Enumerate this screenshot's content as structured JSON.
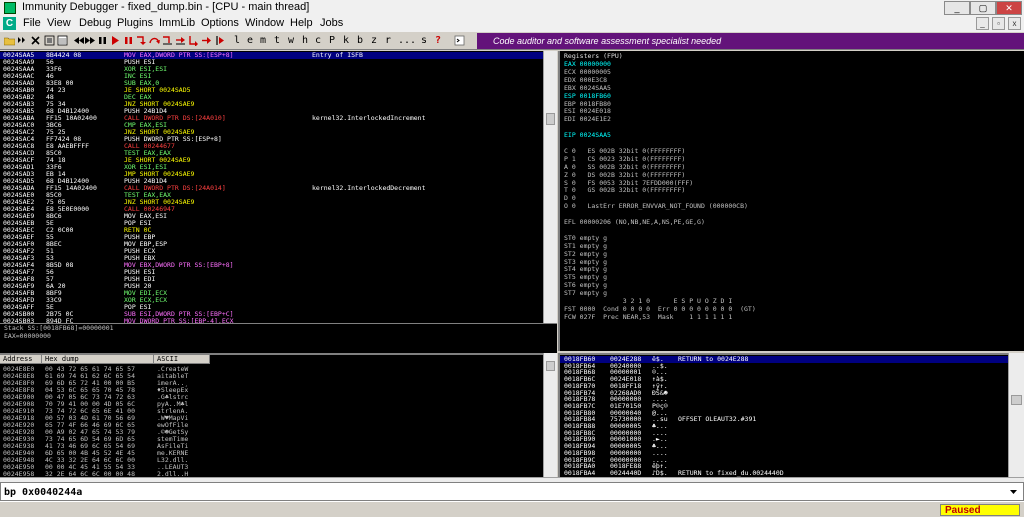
{
  "window": {
    "title": "Immunity Debugger - fixed_dump.bin - [CPU - main thread]",
    "min_label": "_",
    "max_label": "▢",
    "close_label": "✕"
  },
  "menu": {
    "icon_letter": "C",
    "items": [
      "File",
      "View",
      "Debug",
      "Plugins",
      "ImmLib",
      "Options",
      "Window",
      "Help",
      "Jobs"
    ]
  },
  "toolbar": {
    "letters": [
      "l",
      "e",
      "m",
      "t",
      "w",
      "h",
      "c",
      "P",
      "k",
      "b",
      "z",
      "r",
      "...",
      "s",
      "?"
    ],
    "banner": "Code auditor and software assessment specialist needed"
  },
  "disasm": {
    "rows": [
      {
        "addr": "0024SAA5",
        "hex": "8B4424 08",
        "asm": "MOV EAX,DWORD PTR SS:[ESP+8]",
        "cmt": "Entry of ISFB",
        "sel": true,
        "cls": "mov"
      },
      {
        "addr": "0024SAA9",
        "hex": "56",
        "asm": "PUSH ESI",
        "cmt": "",
        "cls": "push"
      },
      {
        "addr": "0024SAAA",
        "hex": "33F6",
        "asm": "XOR ESI,ESI",
        "cmt": "",
        "cls": "arith"
      },
      {
        "addr": "0024SAAC",
        "hex": "46",
        "asm": "INC ESI",
        "cmt": "",
        "cls": "arith"
      },
      {
        "addr": "0024SAAD",
        "hex": "83E8 00",
        "asm": "SUB EAX,0",
        "cmt": "",
        "cls": "arith"
      },
      {
        "addr": "0024SAB0",
        "hex": "74 23",
        "asm": "JE SHORT 0024SAD5",
        "cmt": "",
        "cls": "jmp"
      },
      {
        "addr": "0024SAB2",
        "hex": "48",
        "asm": "DEC EAX",
        "cmt": "",
        "cls": "arith"
      },
      {
        "addr": "0024SAB3",
        "hex": "75 34",
        "asm": "JNZ SHORT 0024SAE9",
        "cmt": "",
        "cls": "jmp"
      },
      {
        "addr": "0024SAB5",
        "hex": "68 D4B12400",
        "asm": "PUSH 24B1D4",
        "cmt": "",
        "cls": "push"
      },
      {
        "addr": "0024SABA",
        "hex": "FF15 10A02400",
        "asm": "CALL DWORD PTR DS:[24A010]",
        "cmt": "kernel32.InterlockedIncrement",
        "cls": "call"
      },
      {
        "addr": "0024SAC0",
        "hex": "3BC6",
        "asm": "CMP EAX,ESI",
        "cmt": "",
        "cls": "arith"
      },
      {
        "addr": "0024SAC2",
        "hex": "75 25",
        "asm": "JNZ SHORT 0024SAE9",
        "cmt": "",
        "cls": "jmp"
      },
      {
        "addr": "0024SAC4",
        "hex": "FF7424 08",
        "asm": "PUSH DWORD PTR SS:[ESP+8]",
        "cmt": "",
        "cls": "push"
      },
      {
        "addr": "0024SAC8",
        "hex": "E8 AAEBFFFF",
        "asm": "CALL 00244677",
        "cmt": "",
        "cls": "call"
      },
      {
        "addr": "0024SACD",
        "hex": "85C0",
        "asm": "TEST EAX,EAX",
        "cmt": "",
        "cls": "arith"
      },
      {
        "addr": "0024SACF",
        "hex": "74 18",
        "asm": "JE SHORT 0024SAE9",
        "cmt": "",
        "cls": "jmp"
      },
      {
        "addr": "0024SAD1",
        "hex": "33F6",
        "asm": "XOR ESI,ESI",
        "cmt": "",
        "cls": "arith"
      },
      {
        "addr": "0024SAD3",
        "hex": "EB 14",
        "asm": "JMP SHORT 0024SAE9",
        "cmt": "",
        "cls": "jmp"
      },
      {
        "addr": "0024SAD5",
        "hex": "68 D4B12400",
        "asm": "PUSH 24B1D4",
        "cmt": "",
        "cls": "push"
      },
      {
        "addr": "0024SADA",
        "hex": "FF15 14A02400",
        "asm": "CALL DWORD PTR DS:[24A014]",
        "cmt": "kernel32.InterlockedDecrement",
        "cls": "call"
      },
      {
        "addr": "0024SAE0",
        "hex": "85C0",
        "asm": "TEST EAX,EAX",
        "cmt": "",
        "cls": "arith"
      },
      {
        "addr": "0024SAE2",
        "hex": "75 05",
        "asm": "JNZ SHORT 0024SAE9",
        "cmt": "",
        "cls": "jmp"
      },
      {
        "addr": "0024SAE4",
        "hex": "E8 5E0E0000",
        "asm": "CALL 00246947",
        "cmt": "",
        "cls": "call"
      },
      {
        "addr": "0024SAE9",
        "hex": "8BC6",
        "asm": "MOV EAX,ESI",
        "cmt": "",
        "cls": "plain"
      },
      {
        "addr": "0024SAEB",
        "hex": "5E",
        "asm": "POP ESI",
        "cmt": "",
        "cls": "push"
      },
      {
        "addr": "0024SAEC",
        "hex": "C2 0C00",
        "asm": "RETN 0C",
        "cmt": "",
        "cls": "jmp"
      },
      {
        "addr": "0024SAEF",
        "hex": "55",
        "asm": "PUSH EBP",
        "cmt": "",
        "cls": "push"
      },
      {
        "addr": "0024SAF0",
        "hex": "8BEC",
        "asm": "MOV EBP,ESP",
        "cmt": "",
        "cls": "plain"
      },
      {
        "addr": "0024SAF2",
        "hex": "51",
        "asm": "PUSH ECX",
        "cmt": "",
        "cls": "push"
      },
      {
        "addr": "0024SAF3",
        "hex": "53",
        "asm": "PUSH EBX",
        "cmt": "",
        "cls": "push"
      },
      {
        "addr": "0024SAF4",
        "hex": "8B5D 08",
        "asm": "MOV EBX,DWORD PTR SS:[EBP+8]",
        "cmt": "",
        "cls": "mov"
      },
      {
        "addr": "0024SAF7",
        "hex": "56",
        "asm": "PUSH ESI",
        "cmt": "",
        "cls": "push"
      },
      {
        "addr": "0024SAF8",
        "hex": "57",
        "asm": "PUSH EDI",
        "cmt": "",
        "cls": "push"
      },
      {
        "addr": "0024SAF9",
        "hex": "6A 20",
        "asm": "PUSH 20",
        "cmt": "",
        "cls": "push"
      },
      {
        "addr": "0024SAFB",
        "hex": "8BF9",
        "asm": "MOV EDI,ECX",
        "cmt": "",
        "cls": "arith"
      },
      {
        "addr": "0024SAFD",
        "hex": "33C9",
        "asm": "XOR ECX,ECX",
        "cmt": "",
        "cls": "arith"
      },
      {
        "addr": "0024SAFF",
        "hex": "5E",
        "asm": "POP ESI",
        "cmt": "",
        "cls": "push"
      },
      {
        "addr": "0024SB00",
        "hex": "2B75 0C",
        "asm": "SUB ESI,DWORD PTR SS:[EBP+C]",
        "cmt": "",
        "cls": "mov"
      },
      {
        "addr": "0024SB03",
        "hex": "894D FC",
        "asm": "MOV DWORD PTR SS:[EBP-4],ECX",
        "cmt": "",
        "cls": "mov"
      }
    ]
  },
  "info": {
    "line1": "Stack SS:[0018FB68]=00000001",
    "line2": "EAX=00000000"
  },
  "registers": {
    "title": "Registers (FPU)",
    "lines": [
      {
        "t": "EAX 00000000",
        "c": "hl"
      },
      {
        "t": "ECX 00000005",
        "c": ""
      },
      {
        "t": "EDX 000E3C8",
        "c": ""
      },
      {
        "t": "EBX 0024SAA5",
        "c": ""
      },
      {
        "t": "ESP 0018FB60",
        "c": "hl"
      },
      {
        "t": "EBP 0018FB80",
        "c": ""
      },
      {
        "t": "ESI 0024E018",
        "c": ""
      },
      {
        "t": "EDI 0024E1E2",
        "c": ""
      },
      {
        "t": "",
        "c": ""
      },
      {
        "t": "EIP 0024SAA5",
        "c": "hl"
      },
      {
        "t": "",
        "c": ""
      },
      {
        "t": "C 0   ES 002B 32bit 0(FFFFFFFF)",
        "c": ""
      },
      {
        "t": "P 1   CS 0023 32bit 0(FFFFFFFF)",
        "c": ""
      },
      {
        "t": "A 0   SS 002B 32bit 0(FFFFFFFF)",
        "c": ""
      },
      {
        "t": "Z 0   DS 002B 32bit 0(FFFFFFFF)",
        "c": ""
      },
      {
        "t": "S 0   FS 0053 32bit 7EFDD000(FFF)",
        "c": ""
      },
      {
        "t": "T 0   GS 002B 32bit 0(FFFFFFFF)",
        "c": ""
      },
      {
        "t": "D 0",
        "c": ""
      },
      {
        "t": "O 0   LastErr ERROR_ENVVAR_NOT_FOUND (000000CB)",
        "c": ""
      },
      {
        "t": "",
        "c": ""
      },
      {
        "t": "EFL 00000206 (NO,NB,NE,A,NS,PE,GE,G)",
        "c": ""
      },
      {
        "t": "",
        "c": ""
      },
      {
        "t": "ST0 empty g",
        "c": ""
      },
      {
        "t": "ST1 empty g",
        "c": ""
      },
      {
        "t": "ST2 empty g",
        "c": ""
      },
      {
        "t": "ST3 empty g",
        "c": ""
      },
      {
        "t": "ST4 empty g",
        "c": ""
      },
      {
        "t": "ST5 empty g",
        "c": ""
      },
      {
        "t": "ST6 empty g",
        "c": ""
      },
      {
        "t": "ST7 empty g",
        "c": ""
      },
      {
        "t": "               3 2 1 0      E S P U O Z D I",
        "c": ""
      },
      {
        "t": "FST 0000  Cond 0 0 0 0  Err 0 0 0 0 0 0 0 0  (GT)",
        "c": ""
      },
      {
        "t": "FCW 027F  Prec NEAR,53  Mask    1 1 1 1 1 1",
        "c": ""
      }
    ]
  },
  "dump": {
    "headers": [
      "Address",
      "Hex dump",
      "ASCII"
    ],
    "rows": [
      {
        "addr": "0024E8E0",
        "hex": "00 43 72 65 61 74 65 57",
        "ascii": ".CreateW"
      },
      {
        "addr": "0024E8E8",
        "hex": "61 69 74 61 62 6C 65 54",
        "ascii": "aitableT"
      },
      {
        "addr": "0024E8F0",
        "hex": "69 6D 65 72 41 00 00 B5",
        "ascii": "imerA..¸"
      },
      {
        "addr": "0024E8F8",
        "hex": "04 53 6C 65 65 70 45 78",
        "ascii": "♦SleepEx"
      },
      {
        "addr": "0024E900",
        "hex": "00 47 05 6C 73 74 72 63",
        "ascii": ".G♣lstrc"
      },
      {
        "addr": "0024E908",
        "hex": "70 79 41 00 00 4D 05 6C",
        "ascii": "pyA..M♣l"
      },
      {
        "addr": "0024E910",
        "hex": "73 74 72 6C 65 6E 41 00",
        "ascii": "strlenA."
      },
      {
        "addr": "0024E918",
        "hex": "00 57 03 4D 61 70 56 69",
        "ascii": ".W♥MapVi"
      },
      {
        "addr": "0024E920",
        "hex": "65 77 4F 66 46 69 6C 65",
        "ascii": "ewOfFile"
      },
      {
        "addr": "0024E928",
        "hex": "00 A9 02 47 65 74 53 79",
        "ascii": ".©☻GetSy"
      },
      {
        "addr": "0024E930",
        "hex": "73 74 65 6D 54 69 6D 65",
        "ascii": "stemTime"
      },
      {
        "addr": "0024E938",
        "hex": "41 73 46 69 6C 65 54 69",
        "ascii": "AsFileTi"
      },
      {
        "addr": "0024E940",
        "hex": "6D 65 00 4B 45 52 4E 45",
        "ascii": "me.KERNE"
      },
      {
        "addr": "0024E948",
        "hex": "4C 33 32 2E 64 6C 6C 00",
        "ascii": "L32.dll."
      },
      {
        "addr": "0024E950",
        "hex": "00 00 4C 45 41 55 54 33",
        "ascii": "..LEAUT3"
      },
      {
        "addr": "0024E958",
        "hex": "32 2E 64 6C 6C 00 00 48",
        "ascii": "2.dll..H"
      }
    ]
  },
  "stack": {
    "rows": [
      {
        "addr": "0018FB60",
        "val": "0024E288",
        "asc": "ê$.",
        "cmt": "RETURN to 0024E288",
        "sel": true
      },
      {
        "addr": "0018FB64",
        "val": "00240000",
        "asc": "..$.",
        "cmt": ""
      },
      {
        "addr": "0018FB68",
        "val": "00000001",
        "asc": "☺...",
        "cmt": ""
      },
      {
        "addr": "0018FB6C",
        "val": "0024E018",
        "asc": "↑à$.",
        "cmt": ""
      },
      {
        "addr": "0018FB70",
        "val": "0018FF18",
        "asc": "↑ÿ↑.",
        "cmt": ""
      },
      {
        "addr": "0018FB74",
        "val": "02268AD0",
        "asc": "ÐŠ&☻",
        "cmt": ""
      },
      {
        "addr": "0018FB78",
        "val": "00000000",
        "asc": "....",
        "cmt": ""
      },
      {
        "addr": "0018FB7C",
        "val": "01E70150",
        "asc": "P☺ç☺",
        "cmt": ""
      },
      {
        "addr": "0018FB80",
        "val": "00000040",
        "asc": "@...",
        "cmt": ""
      },
      {
        "addr": "0018FB84",
        "val": "75730000",
        "asc": "..su",
        "cmt": "OFFSET OLEAUT32.#391"
      },
      {
        "addr": "0018FB88",
        "val": "00000005",
        "asc": "♣...",
        "cmt": ""
      },
      {
        "addr": "0018FB8C",
        "val": "00000000",
        "asc": "....",
        "cmt": ""
      },
      {
        "addr": "0018FB90",
        "val": "00001000",
        "asc": ".►..",
        "cmt": ""
      },
      {
        "addr": "0018FB94",
        "val": "00000005",
        "asc": "♣...",
        "cmt": ""
      },
      {
        "addr": "0018FB98",
        "val": "00000000",
        "asc": "....",
        "cmt": ""
      },
      {
        "addr": "0018FB9C",
        "val": "00000000",
        "asc": "....",
        "cmt": ""
      },
      {
        "addr": "0018FBA0",
        "val": "0018FE88",
        "asc": "êþ↑.",
        "cmt": ""
      },
      {
        "addr": "0018FBA4",
        "val": "0024440D",
        "asc": "♪D$.",
        "cmt": "RETURN to fixed_du.0024440D"
      }
    ]
  },
  "command": {
    "value": "bp 0x0040244a"
  },
  "status": {
    "state": "Paused"
  }
}
